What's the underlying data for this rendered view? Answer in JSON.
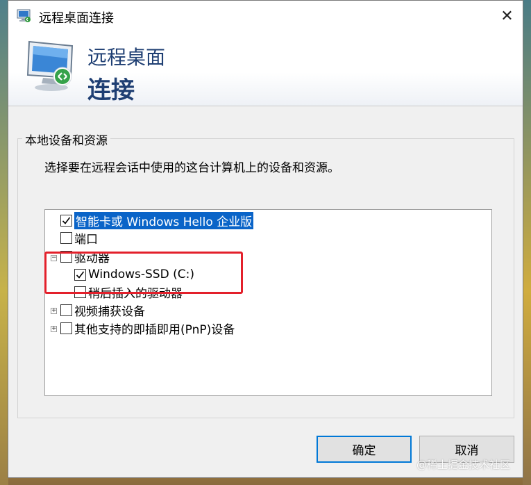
{
  "window": {
    "title": "远程桌面连接",
    "close_glyph": "✕"
  },
  "banner": {
    "line1": "远程桌面",
    "line2": "连接"
  },
  "group": {
    "label": "本地设备和资源",
    "description": "选择要在远程会话中使用的这台计算机上的设备和资源。"
  },
  "tree": {
    "items": [
      {
        "label": "智能卡或 Windows Hello 企业版",
        "checked": true,
        "selected": true
      },
      {
        "label": "端口",
        "checked": false
      },
      {
        "label": "驱动器",
        "checked": false,
        "expander": "−"
      },
      {
        "label": "Windows-SSD (C:)",
        "checked": true
      },
      {
        "label": "稍后插入的驱动器",
        "checked": false
      },
      {
        "label": "视频捕获设备",
        "checked": false,
        "expander": "+"
      },
      {
        "label": "其他支持的即插即用(PnP)设备",
        "checked": false,
        "expander": "+"
      }
    ]
  },
  "buttons": {
    "ok": "确定",
    "cancel": "取消"
  },
  "watermark": "@稀土掘金技术社区",
  "colors": {
    "accent": "#0078d7",
    "selection": "#0a64c8",
    "banner_text": "#1f3f73",
    "highlight": "#e3202b"
  }
}
